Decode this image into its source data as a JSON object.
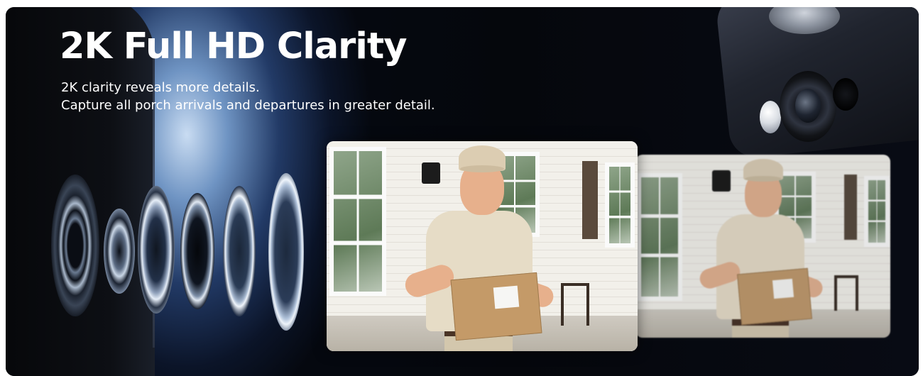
{
  "banner": {
    "headline": "2K Full HD Clarity",
    "subtitle_line1": "2K clarity reveals more details.",
    "subtitle_line2": "Capture all porch arrivals and departures in greater detail."
  },
  "comparison": {
    "left_image": "sharp-delivery-photo",
    "right_image": "blurred-delivery-photo"
  },
  "colors": {
    "background": "#05070c",
    "glow": "#6f94c3",
    "text": "#ffffff"
  }
}
